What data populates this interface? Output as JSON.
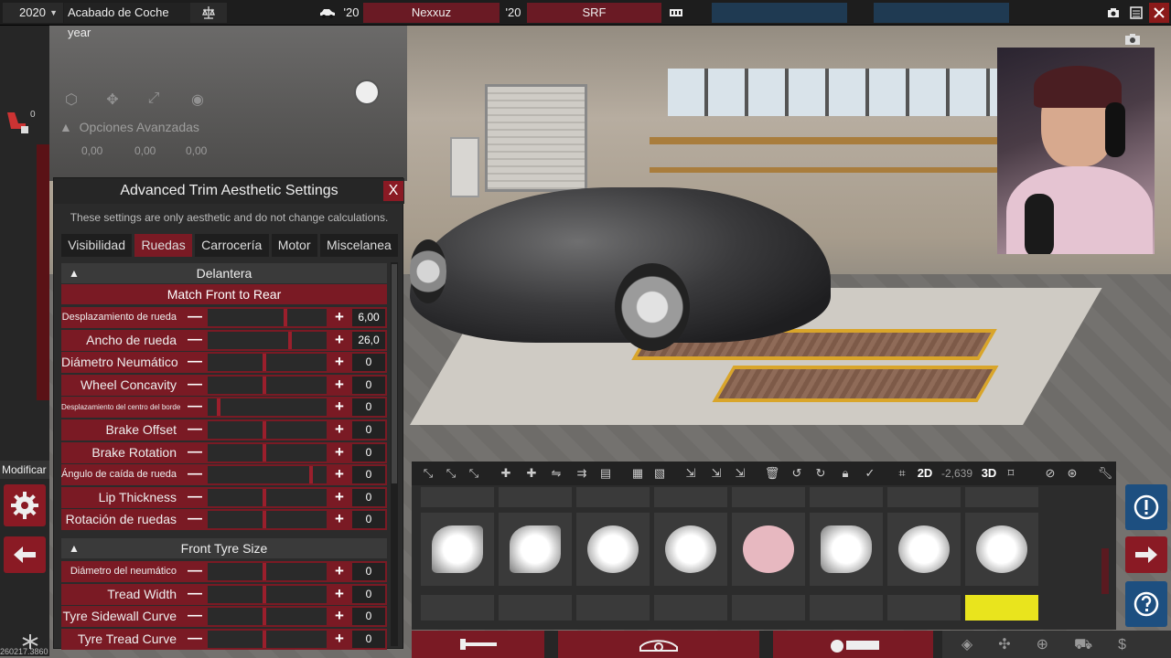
{
  "topbar": {
    "year": "2020",
    "model_name": "Acabado de Coche year",
    "car_year": "'20",
    "car_name": "Nexxuz",
    "engine_year": "'20",
    "engine_name": "SRF"
  },
  "ghost_toolbar": {
    "advanced_options": "Opciones Avanzadas",
    "x": "0,00",
    "y": "0,00",
    "z": "0,00"
  },
  "left": {
    "count": "0",
    "modify_label": "Modificar",
    "version": "260217.3860"
  },
  "panel": {
    "title": "Advanced Trim Aesthetic Settings",
    "close": "X",
    "note": "These settings are only aesthetic and do not change calculations.",
    "tabs": [
      "Visibilidad",
      "Ruedas",
      "Carrocería",
      "Motor",
      "Miscelanea"
    ],
    "active_tab": "Ruedas",
    "section_front": "Delantera",
    "match": "Match Front to Rear",
    "rows": [
      {
        "label": "Desplazamiento de rueda",
        "value": "6,00",
        "level": 0.66
      },
      {
        "label": "Ancho de rueda",
        "value": "26,0",
        "level": 0.7
      },
      {
        "label": "Diámetro Neumático",
        "value": "0",
        "level": 0.48
      },
      {
        "label": "Wheel Concavity",
        "value": "0",
        "level": 0.48
      },
      {
        "label": "Desplazamiento del centro del borde",
        "value": "0",
        "level": 0.08
      },
      {
        "label": "Brake Offset",
        "value": "0",
        "level": 0.48
      },
      {
        "label": "Brake Rotation",
        "value": "0",
        "level": 0.48
      },
      {
        "label": "Ángulo de caída de rueda",
        "value": "0",
        "level": 0.88
      },
      {
        "label": "Lip Thickness",
        "value": "0",
        "level": 0.48
      },
      {
        "label": "Rotación de ruedas",
        "value": "0",
        "level": 0.48
      }
    ],
    "section_tyre": "Front Tyre Size",
    "tyre_rows": [
      {
        "label": "Diámetro del neumático",
        "value": "0",
        "level": 0.48
      },
      {
        "label": "Tread Width",
        "value": "0",
        "level": 0.48
      },
      {
        "label": "Tyre Sidewall Curve",
        "value": "0",
        "level": 0.48
      },
      {
        "label": "Tyre Tread Curve",
        "value": "0",
        "level": 0.48
      }
    ]
  },
  "asset_toolbar": {
    "mode_2d": "2D",
    "coord": "-2,639",
    "mode_3d": "3D"
  },
  "colors": {
    "accent_red": "#7a1a24",
    "blue": "#1d4f80",
    "dark": "#2b2b2b"
  }
}
